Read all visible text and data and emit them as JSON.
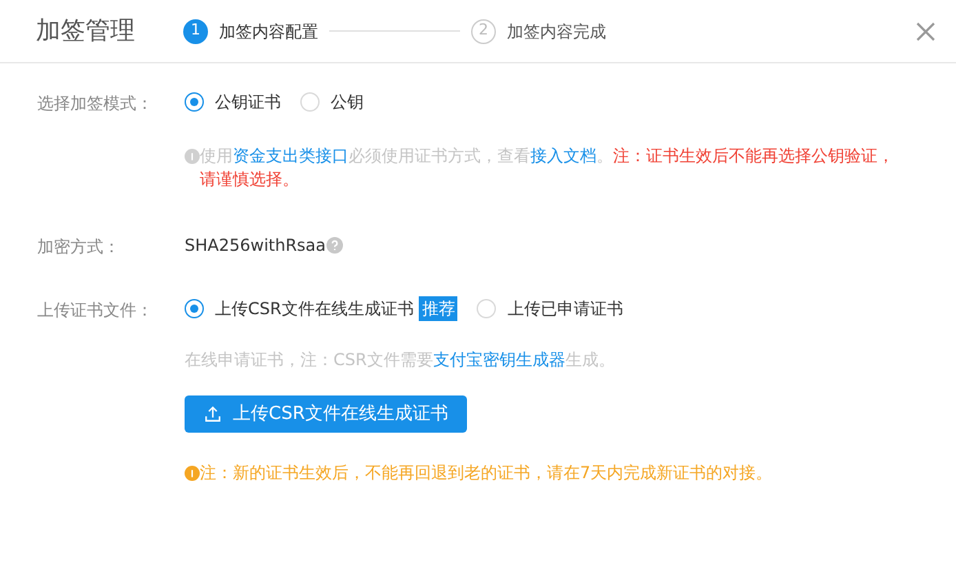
{
  "dialog": {
    "title": "加签管理"
  },
  "steps": [
    {
      "number": "1",
      "label": "加签内容配置",
      "selected": true
    },
    {
      "number": "2",
      "label": "加签内容完成",
      "selected": false
    }
  ],
  "sign_mode": {
    "label": "选择加签模式：",
    "options": [
      {
        "label": "公钥证书",
        "selected": true
      },
      {
        "label": "公钥",
        "selected": false
      }
    ],
    "hint": [
      {
        "kind": "plain",
        "text": "使用"
      },
      {
        "kind": "link",
        "text": "资金支出类接口"
      },
      {
        "kind": "plain",
        "text": "必须使用证书方式，查看"
      },
      {
        "kind": "link",
        "text": "接入文档"
      },
      {
        "kind": "plain",
        "text": "。"
      },
      {
        "kind": "warning",
        "text": "注：证书生效后不能再选择公钥验证，请谨慎选择。"
      }
    ]
  },
  "encryption": {
    "label": "加密方式：",
    "value": "SHA256withRsaa"
  },
  "upload": {
    "label": "上传证书文件：",
    "options": [
      {
        "label": "上传CSR文件在线生成证书",
        "badge": "推荐",
        "selected": true
      },
      {
        "label": "上传已申请证书",
        "selected": false
      }
    ],
    "hint": [
      {
        "kind": "plain",
        "text": "在线申请证书，注：CSR文件需要"
      },
      {
        "kind": "link",
        "text": "支付宝密钥生成器"
      },
      {
        "kind": "plain",
        "text": "生成。"
      }
    ],
    "button": "上传CSR文件在线生成证书",
    "note": "注：新的证书生效后，不能再回退到老的证书，请在7天内完成新证书的对接。"
  }
}
